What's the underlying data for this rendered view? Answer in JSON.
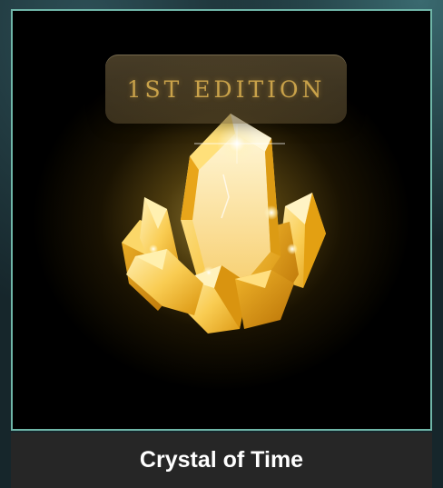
{
  "card": {
    "title": "Crystal of Time",
    "edition_label": "1ST EDITION",
    "art_icon": "gold-crystal-cluster-icon",
    "colors": {
      "border": "#6fb6a8",
      "art_background": "#000000",
      "crystal_gold": "#f2b51c",
      "edition_text": "#c9a24a",
      "title_bar": "#262626",
      "title_text": "#ffffff"
    }
  }
}
